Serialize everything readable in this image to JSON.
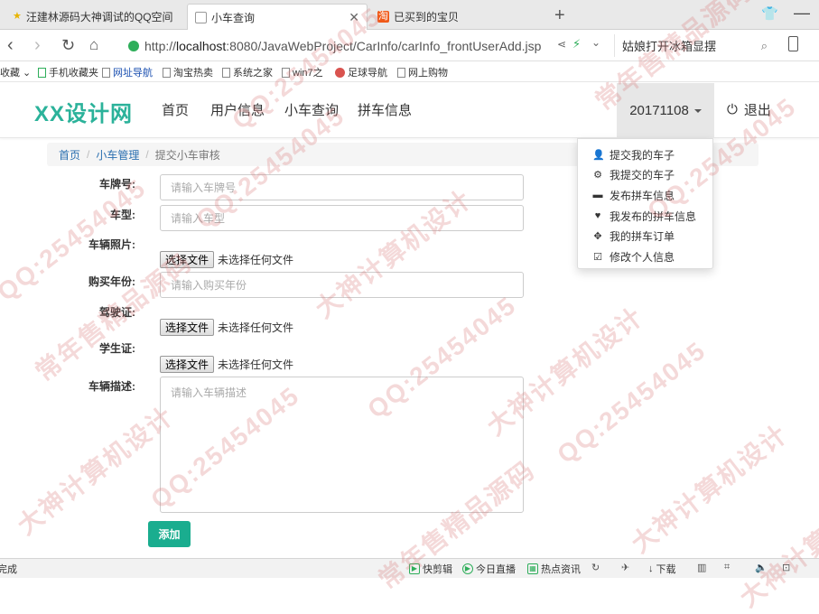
{
  "browser": {
    "tabs": [
      {
        "label": "汪建林源码大神调试的QQ空间"
      },
      {
        "label": "小车查询"
      },
      {
        "label": "已买到的宝贝"
      }
    ],
    "new_tab": "+",
    "url_prefix": "http://",
    "url_host": "localhost",
    "url_rest": ":8080/JavaWebProject/CarInfo/carInfo_frontUserAdd.jsp",
    "search_text": "姑娘打开冰箱显摆",
    "bookmarks": [
      "收藏",
      "手机收藏夹",
      "网址导航",
      "淘宝热卖",
      "系统之家",
      "win7之",
      "足球导航",
      "网上购物"
    ],
    "status_left": "完成",
    "status_items": [
      "快剪辑",
      "今日直播",
      "热点资讯",
      "下载"
    ]
  },
  "site": {
    "brand": "XX设计网",
    "nav": [
      "首页",
      "用户信息",
      "小车查询",
      "拼车信息"
    ],
    "user": "20171108",
    "logout": "退出",
    "dropdown": [
      {
        "icon": "user-icon",
        "label": "提交我的车子"
      },
      {
        "icon": "gear-icon",
        "label": "我提交的车子"
      },
      {
        "icon": "card-icon",
        "label": "发布拼车信息"
      },
      {
        "icon": "heart-icon",
        "label": "我发布的拼车信息"
      },
      {
        "icon": "move-icon",
        "label": "我的拼车订单"
      },
      {
        "icon": "edit-icon",
        "label": "修改个人信息"
      }
    ]
  },
  "breadcrumb": [
    "首页",
    "小车管理",
    "提交小车审核"
  ],
  "form": {
    "plate_label": "车牌号:",
    "plate_placeholder": "请输入车牌号",
    "model_label": "车型:",
    "model_placeholder": "请输入车型",
    "photo_label": "车辆照片:",
    "year_label": "购买年份:",
    "year_placeholder": "请输入购买年份",
    "license_label": "驾驶证:",
    "student_label": "学生证:",
    "desc_label": "车辆描述:",
    "desc_placeholder": "请输入车辆描述",
    "file_button": "选择文件",
    "file_none": "未选择任何文件",
    "submit": "添加"
  },
  "watermark": [
    "常年售精品源码",
    "QQ:25454045",
    "大神计算机设计"
  ]
}
